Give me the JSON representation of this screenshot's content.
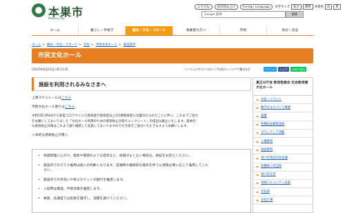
{
  "header": {
    "logo_name": "本巣市",
    "logo_sub": "Motosu City",
    "util": {
      "furigana": "ふりがな",
      "voice": "音声読み上げ",
      "foreign": "Foreign Language",
      "font_size_label": "文字サイズ",
      "enlarge": "拡大",
      "standard": "標準",
      "bg_color_label": "背景色",
      "bg_white": "白",
      "bg_black": "黒"
    },
    "search_placeholder": "Google 提供",
    "search_button": "検索"
  },
  "nav": [
    {
      "label": "ホーム",
      "active": false
    },
    {
      "label": "暮らし・手続き",
      "active": false
    },
    {
      "label": "観光・文化・スポーツ",
      "active": true
    },
    {
      "label": "事業者の方へ",
      "active": false
    },
    {
      "label": "市政",
      "active": false
    },
    {
      "label": "防災・安全",
      "active": false
    }
  ],
  "breadcrumb": [
    "ホーム",
    "観光・文化・スポーツ",
    "文化",
    "市民文化ホール",
    "施設案内"
  ],
  "page": {
    "title": "市民文化ホール",
    "meta": "[2022年6月14日] ID:1116",
    "notice": "ソーシャルサイトへのリンクは別ウィンドウで開きます",
    "share": [
      "ツイート",
      "シェア",
      "LINEで送る"
    ],
    "share_colors": [
      "#1da1f2",
      "#3b5998",
      "#06c755"
    ]
  },
  "content": {
    "section_title": "施設を利用されるみなさまへ",
    "schedule_prefix": "上演スケジュールは",
    "schedule_link": "こちら",
    "usage_prefix": "市民文化ホール使りは",
    "usage_link": "こちら",
    "body": [
      "令和5年5月8日から新型コロナウイルス感染症が感染症法上の5類感染症に位置付けられたことに伴い、これまでご協力",
      "をお願いしてまいりました「文化ホール利用のための感染防止対策チェックシート」の提出は廃止いたします。基本的",
      "な感染防止対策はこれまで通り継続して実施してまいりますので引き続きご協力いただきますようお願いします。"
    ],
    "basic_policy": "＜本的な感染防止対策＞",
    "bullets": [
      "体調管理に心がけ、発熱や風邪のような症状など、体調がよくない場合は、来館をお控えください。",
      "施設内でのマスク着用は個人の判断となります。自唯時や継続的な発声を伴う公演等必要に応じて着用してくだ",
      "さい。",
      "施設内での手洗いや咳エチケットの励行を推奨します。",
      "入館時は検温、手指消毒を推奨します。",
      "楽屋、会議室では定員を遵守し、混雑を避けてください。"
    ]
  },
  "sidebar": {
    "heading": "真正分庁舎 教育委員会 社会教育課 文化ホール",
    "items": [
      "文化・イベント",
      "数学のまちづくり事業",
      "図書",
      "各種社会教育団体",
      "ボランティア活動",
      "人権教育",
      "家庭教育",
      "青少年育成市民会議",
      "各種青少年団体",
      "青少年交流",
      "地域コミュニティ支援",
      "文化財",
      "文化行事"
    ]
  }
}
